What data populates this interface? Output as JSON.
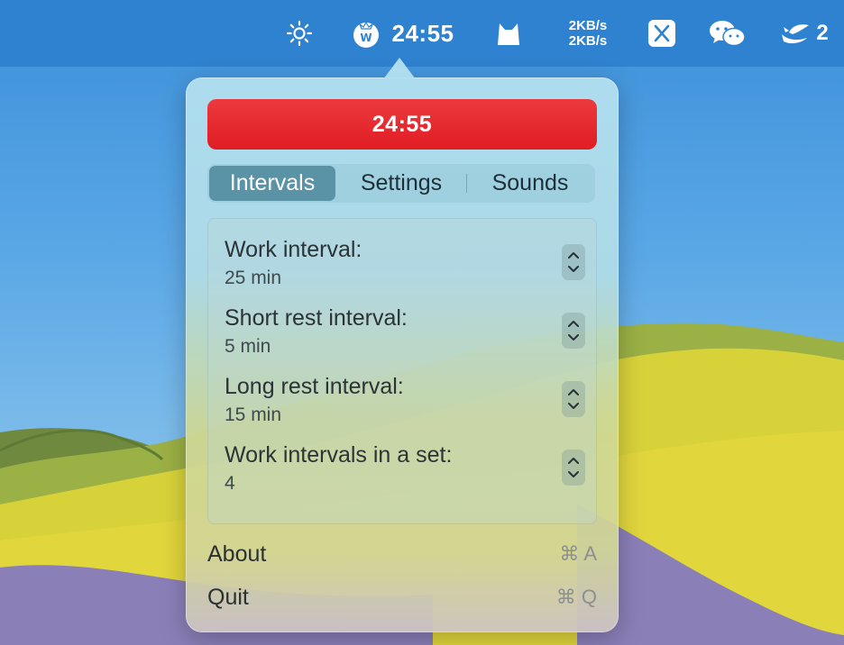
{
  "menubar": {
    "timer": "24:55",
    "net_up": "2KB/s",
    "net_down": "2KB/s",
    "badge_count": "2",
    "icons": [
      "brightness-icon",
      "tomato-icon",
      "cat-icon",
      "x-icon",
      "wechat-icon",
      "bird-icon"
    ]
  },
  "popover": {
    "timer_button": "24:55",
    "tabs": [
      {
        "label": "Intervals",
        "selected": true
      },
      {
        "label": "Settings",
        "selected": false
      },
      {
        "label": "Sounds",
        "selected": false
      }
    ],
    "intervals": [
      {
        "label": "Work interval:",
        "value": "25 min"
      },
      {
        "label": "Short rest interval:",
        "value": "5 min"
      },
      {
        "label": "Long rest interval:",
        "value": "15 min"
      },
      {
        "label": "Work intervals in a set:",
        "value": "4"
      }
    ],
    "menu": [
      {
        "label": "About",
        "shortcut": "⌘ A"
      },
      {
        "label": "Quit",
        "shortcut": "⌘ Q"
      }
    ]
  },
  "colors": {
    "menubar": "#2f82cf",
    "timer_red": "#e01d24",
    "tab_active": "#5a93a5"
  }
}
